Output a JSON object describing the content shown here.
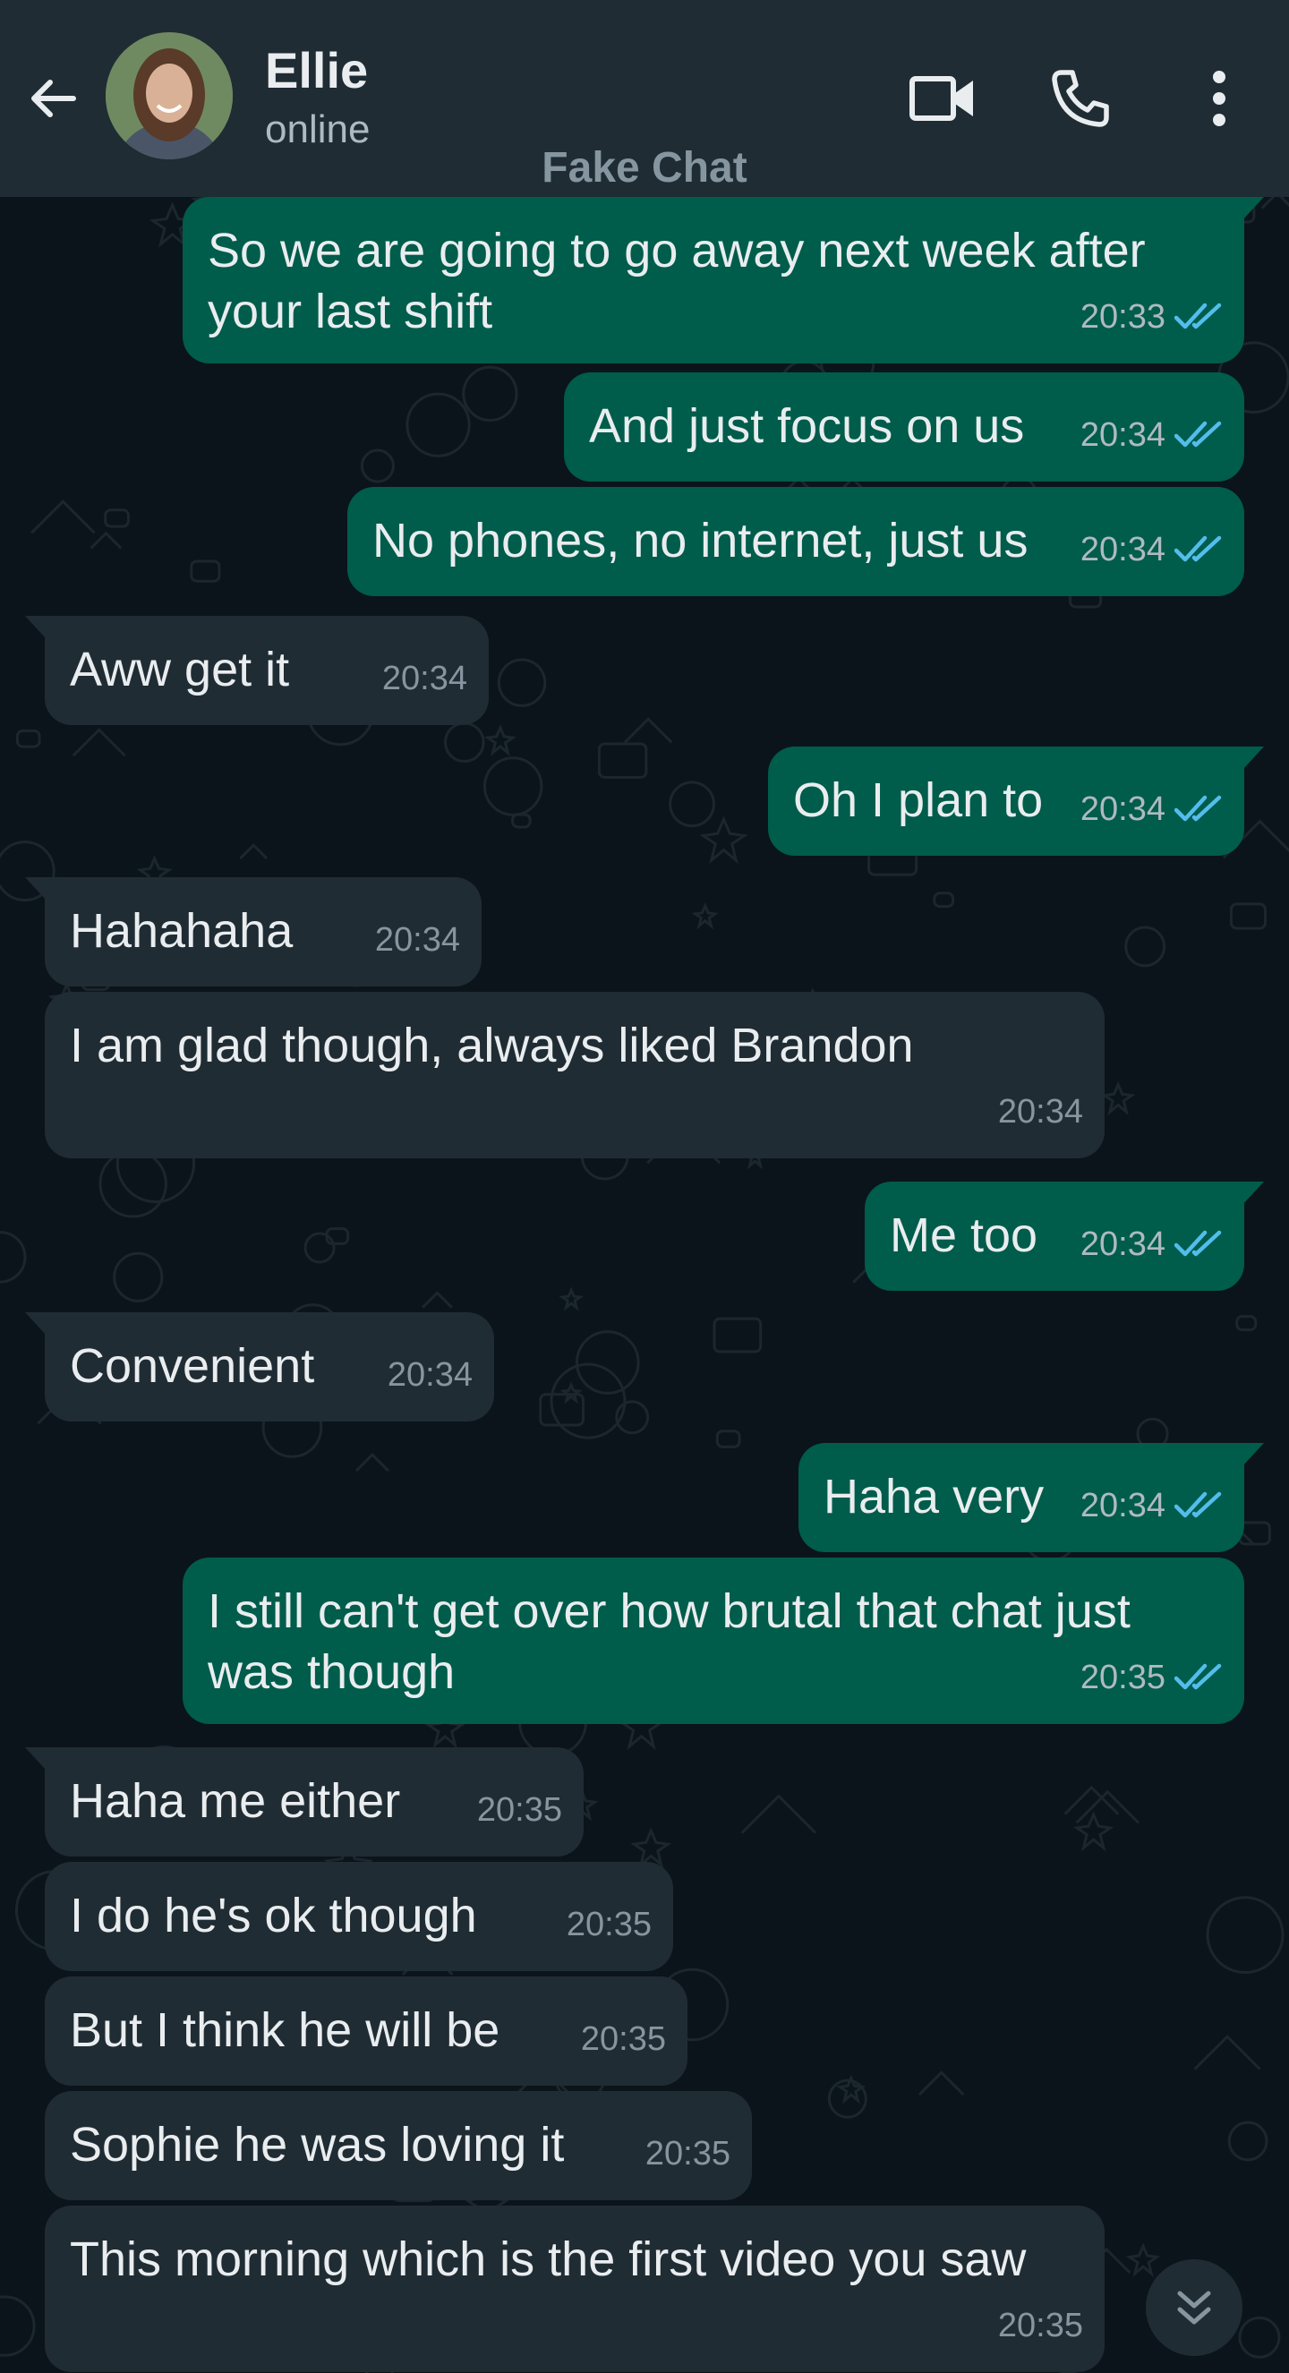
{
  "header": {
    "contact_name": "Ellie",
    "status": "online",
    "watermark": "Fake Chat",
    "icons": [
      "back-arrow-icon",
      "video-call-icon",
      "phone-icon",
      "more-vert-icon"
    ]
  },
  "colors": {
    "header_bg": "#1f2c34",
    "chat_bg": "#0b141a",
    "outgoing_bubble": "#005c4b",
    "incoming_bubble": "#202c33",
    "read_ticks": "#53bdeb"
  },
  "messages": [
    {
      "dir": "out",
      "text_lines": [
        "So we are going to go away next week after",
        "your last shift"
      ],
      "time": "20:33",
      "ticks": true
    },
    {
      "dir": "out",
      "text_lines": [
        "And just focus on us"
      ],
      "time": "20:34",
      "ticks": true
    },
    {
      "dir": "out",
      "text_lines": [
        "No phones, no internet, just us"
      ],
      "time": "20:34",
      "ticks": true
    },
    {
      "dir": "in",
      "text_lines": [
        "Aww get it"
      ],
      "time": "20:34"
    },
    {
      "dir": "out",
      "text_lines": [
        "Oh I plan to"
      ],
      "time": "20:34",
      "ticks": true
    },
    {
      "dir": "in",
      "text_lines": [
        "Hahahaha"
      ],
      "time": "20:34"
    },
    {
      "dir": "in",
      "text_lines": [
        "I am glad though, always liked Brandon"
      ],
      "time": "20:34"
    },
    {
      "dir": "out",
      "text_lines": [
        "Me too"
      ],
      "time": "20:34",
      "ticks": true
    },
    {
      "dir": "in",
      "text_lines": [
        "Convenient"
      ],
      "time": "20:34"
    },
    {
      "dir": "out",
      "text_lines": [
        "Haha very"
      ],
      "time": "20:34",
      "ticks": true
    },
    {
      "dir": "out",
      "text_lines": [
        "I still can't get over how brutal that chat just",
        "was though"
      ],
      "time": "20:35",
      "ticks": true
    },
    {
      "dir": "in",
      "text_lines": [
        "Haha me either"
      ],
      "time": "20:35"
    },
    {
      "dir": "in",
      "text_lines": [
        "I do he's ok though"
      ],
      "time": "20:35"
    },
    {
      "dir": "in",
      "text_lines": [
        "But I think he will be"
      ],
      "time": "20:35"
    },
    {
      "dir": "in",
      "text_lines": [
        "Sophie he was loving it"
      ],
      "time": "20:35"
    },
    {
      "dir": "in",
      "text_lines": [
        "This morning which is the first video you saw"
      ],
      "time": "20:35"
    }
  ]
}
